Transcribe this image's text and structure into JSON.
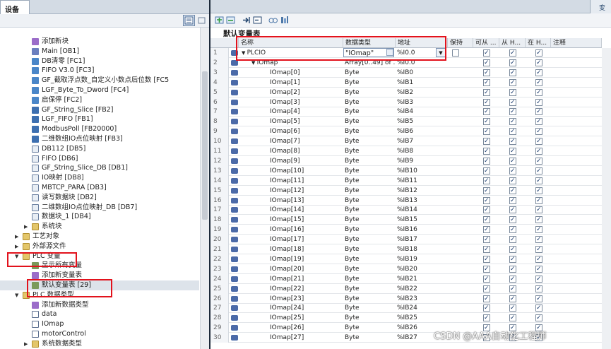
{
  "left_panel": {
    "tab_title": "设备",
    "tree": [
      {
        "label": "添加新块",
        "icon": "add-block-icon",
        "kind": "add",
        "indent": 3
      },
      {
        "label": "Main [OB1]",
        "icon": "ob-icon",
        "kind": "ob",
        "indent": 3
      },
      {
        "label": "DB清零 [FC1]",
        "icon": "fc-icon",
        "kind": "fc",
        "indent": 3
      },
      {
        "label": "FIFO V3.0 [FC3]",
        "icon": "fc-icon",
        "kind": "fc",
        "indent": 3
      },
      {
        "label": "GF_截取浮点数_自定义小数点后位数 [FC5",
        "icon": "fc-icon",
        "kind": "fc",
        "indent": 3
      },
      {
        "label": "LGF_Byte_To_Dword [FC4]",
        "icon": "fc-icon",
        "kind": "fc",
        "indent": 3
      },
      {
        "label": "启保停 [FC2]",
        "icon": "fc-icon",
        "kind": "fc",
        "indent": 3
      },
      {
        "label": "GF_String_Slice [FB2]",
        "icon": "fb-icon",
        "kind": "fb",
        "indent": 3
      },
      {
        "label": "LGF_FIFO [FB1]",
        "icon": "fb-icon",
        "kind": "fb",
        "indent": 3
      },
      {
        "label": "ModbusPoll [FB20000]",
        "icon": "fb-icon",
        "kind": "fb",
        "indent": 3
      },
      {
        "label": "二维数组IO点位映射 [FB3]",
        "icon": "fb-icon",
        "kind": "fb",
        "indent": 3
      },
      {
        "label": "DB112 [DB5]",
        "icon": "db-icon",
        "kind": "db",
        "indent": 3
      },
      {
        "label": "FIFO [DB6]",
        "icon": "db-icon",
        "kind": "db",
        "indent": 3
      },
      {
        "label": "GF_String_Slice_DB [DB1]",
        "icon": "db-icon",
        "kind": "db",
        "indent": 3
      },
      {
        "label": "IO映射 [DB8]",
        "icon": "db-icon",
        "kind": "db",
        "indent": 3
      },
      {
        "label": "MBTCP_PARA [DB3]",
        "icon": "db-icon",
        "kind": "db",
        "indent": 3
      },
      {
        "label": "读写数据块 [DB2]",
        "icon": "db-icon",
        "kind": "db",
        "indent": 3
      },
      {
        "label": "二维数组IO点位映射_DB [DB7]",
        "icon": "db-icon",
        "kind": "db",
        "indent": 3
      },
      {
        "label": "数据块_1 [DB4]",
        "icon": "db-icon",
        "kind": "db",
        "indent": 3
      },
      {
        "label": "系统块",
        "icon": "folder-icon",
        "kind": "folder",
        "indent": 2,
        "toggle": "▶"
      },
      {
        "label": "工艺对象",
        "icon": "folder-icon",
        "kind": "folder",
        "indent": 1,
        "toggle": "▶"
      },
      {
        "label": "外部源文件",
        "icon": "folder-icon",
        "kind": "folder",
        "indent": 1,
        "toggle": "▶"
      },
      {
        "label": "PLC 变量",
        "icon": "folder-icon",
        "kind": "folder",
        "indent": 1,
        "toggle": "▼"
      },
      {
        "label": "显示所有变量",
        "icon": "tag-icon",
        "kind": "tag",
        "indent": 2
      },
      {
        "label": "添加新变量表",
        "icon": "add-table-icon",
        "kind": "add",
        "indent": 2
      },
      {
        "label": "默认变量表 [29]",
        "icon": "tag-table-icon",
        "kind": "tag",
        "indent": 2,
        "selected": true
      },
      {
        "label": "PLC 数据类型",
        "icon": "folder-icon",
        "kind": "folder",
        "indent": 1,
        "toggle": "▼"
      },
      {
        "label": "添加新数据类型",
        "icon": "add-type-icon",
        "kind": "add",
        "indent": 2
      },
      {
        "label": "data",
        "icon": "udt-icon",
        "kind": "type",
        "indent": 2
      },
      {
        "label": "IOmap",
        "icon": "udt-icon",
        "kind": "type",
        "indent": 2
      },
      {
        "label": "motorControl",
        "icon": "udt-icon",
        "kind": "type",
        "indent": 2
      },
      {
        "label": "系统数据类型",
        "icon": "folder-icon",
        "kind": "folder",
        "indent": 2,
        "toggle": "▶"
      }
    ]
  },
  "right_panel": {
    "tab_hint": "变",
    "table_title": "默认变量表",
    "columns": [
      "名称",
      "数据类型",
      "地址",
      "保持",
      "可从 ...",
      "从 H...",
      "在 H...",
      "注释"
    ],
    "rows": [
      {
        "n": "1",
        "name": "PLCIO",
        "type": "\"IOmap\"",
        "addr": "%I0.0",
        "level": 0,
        "toggle": "▼"
      },
      {
        "n": "2",
        "name": "IOmap",
        "type": "Array[0..49] of ...",
        "addr": "%I0.0",
        "level": 1,
        "toggle": "▼"
      },
      {
        "n": "3",
        "name": "IOmap[0]",
        "type": "Byte",
        "addr": "%IB0",
        "level": 2
      },
      {
        "n": "4",
        "name": "IOmap[1]",
        "type": "Byte",
        "addr": "%IB1",
        "level": 2
      },
      {
        "n": "5",
        "name": "IOmap[2]",
        "type": "Byte",
        "addr": "%IB2",
        "level": 2
      },
      {
        "n": "6",
        "name": "IOmap[3]",
        "type": "Byte",
        "addr": "%IB3",
        "level": 2
      },
      {
        "n": "7",
        "name": "IOmap[4]",
        "type": "Byte",
        "addr": "%IB4",
        "level": 2
      },
      {
        "n": "8",
        "name": "IOmap[5]",
        "type": "Byte",
        "addr": "%IB5",
        "level": 2
      },
      {
        "n": "9",
        "name": "IOmap[6]",
        "type": "Byte",
        "addr": "%IB6",
        "level": 2
      },
      {
        "n": "10",
        "name": "IOmap[7]",
        "type": "Byte",
        "addr": "%IB7",
        "level": 2
      },
      {
        "n": "11",
        "name": "IOmap[8]",
        "type": "Byte",
        "addr": "%IB8",
        "level": 2
      },
      {
        "n": "12",
        "name": "IOmap[9]",
        "type": "Byte",
        "addr": "%IB9",
        "level": 2
      },
      {
        "n": "13",
        "name": "IOmap[10]",
        "type": "Byte",
        "addr": "%IB10",
        "level": 2
      },
      {
        "n": "14",
        "name": "IOmap[11]",
        "type": "Byte",
        "addr": "%IB11",
        "level": 2
      },
      {
        "n": "15",
        "name": "IOmap[12]",
        "type": "Byte",
        "addr": "%IB12",
        "level": 2
      },
      {
        "n": "16",
        "name": "IOmap[13]",
        "type": "Byte",
        "addr": "%IB13",
        "level": 2
      },
      {
        "n": "17",
        "name": "IOmap[14]",
        "type": "Byte",
        "addr": "%IB14",
        "level": 2
      },
      {
        "n": "18",
        "name": "IOmap[15]",
        "type": "Byte",
        "addr": "%IB15",
        "level": 2
      },
      {
        "n": "19",
        "name": "IOmap[16]",
        "type": "Byte",
        "addr": "%IB16",
        "level": 2
      },
      {
        "n": "20",
        "name": "IOmap[17]",
        "type": "Byte",
        "addr": "%IB17",
        "level": 2
      },
      {
        "n": "21",
        "name": "IOmap[18]",
        "type": "Byte",
        "addr": "%IB18",
        "level": 2
      },
      {
        "n": "22",
        "name": "IOmap[19]",
        "type": "Byte",
        "addr": "%IB19",
        "level": 2
      },
      {
        "n": "23",
        "name": "IOmap[20]",
        "type": "Byte",
        "addr": "%IB20",
        "level": 2
      },
      {
        "n": "24",
        "name": "IOmap[21]",
        "type": "Byte",
        "addr": "%IB21",
        "level": 2
      },
      {
        "n": "25",
        "name": "IOmap[22]",
        "type": "Byte",
        "addr": "%IB22",
        "level": 2
      },
      {
        "n": "26",
        "name": "IOmap[23]",
        "type": "Byte",
        "addr": "%IB23",
        "level": 2
      },
      {
        "n": "27",
        "name": "IOmap[24]",
        "type": "Byte",
        "addr": "%IB24",
        "level": 2
      },
      {
        "n": "28",
        "name": "IOmap[25]",
        "type": "Byte",
        "addr": "%IB25",
        "level": 2
      },
      {
        "n": "29",
        "name": "IOmap[26]",
        "type": "Byte",
        "addr": "%IB26",
        "level": 2
      },
      {
        "n": "30",
        "name": "IOmap[27]",
        "type": "Byte",
        "addr": "%IB27",
        "level": 2
      }
    ]
  },
  "watermark": "CSDN @AAA自动化工程师",
  "colors": {
    "highlight": "#e2121c",
    "header_bg": "#d3dbe4",
    "splitter": "#1d2a3a",
    "selected_row": "#dde3ea"
  }
}
